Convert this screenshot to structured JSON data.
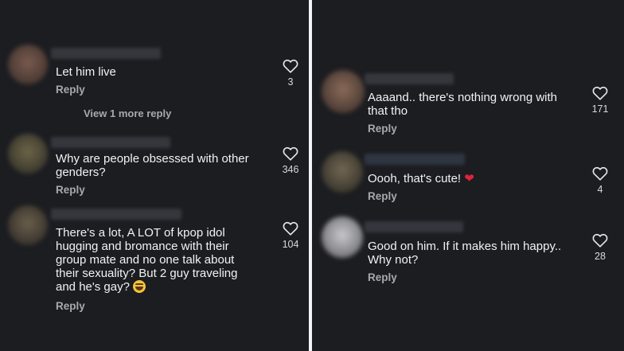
{
  "colors": {
    "background": "#1c1d21",
    "text": "#f2f2f2",
    "muted": "#a7a9ae",
    "heart_emoji": "#e0243a"
  },
  "left_panel": {
    "comments": [
      {
        "text": "Let him live",
        "reply_label": "Reply",
        "likes": "3",
        "view_more": "View 1 more reply"
      },
      {
        "text": "Why are people obsessed with other\ngenders?",
        "reply_label": "Reply",
        "likes": "346"
      },
      {
        "text": "There's a lot, A LOT of kpop idol\nhugging and bromance with their\ngroup mate and no one talk about\ntheir sexuality? But 2 guy traveling\nand he's gay?",
        "emoji": "laughing-emoji",
        "reply_label": "Reply",
        "likes": "104"
      }
    ]
  },
  "right_panel": {
    "comments": [
      {
        "text": "Aaaand.. there's nothing wrong with\nthat tho",
        "reply_label": "Reply",
        "likes": "171"
      },
      {
        "text": "Oooh, that's cute!",
        "emoji": "red-heart-emoji",
        "emoji_char": "❤",
        "reply_label": "Reply",
        "likes": "4"
      },
      {
        "text": "Good on him. If it makes him happy..\nWhy not?",
        "reply_label": "Reply",
        "likes": "28"
      }
    ]
  }
}
